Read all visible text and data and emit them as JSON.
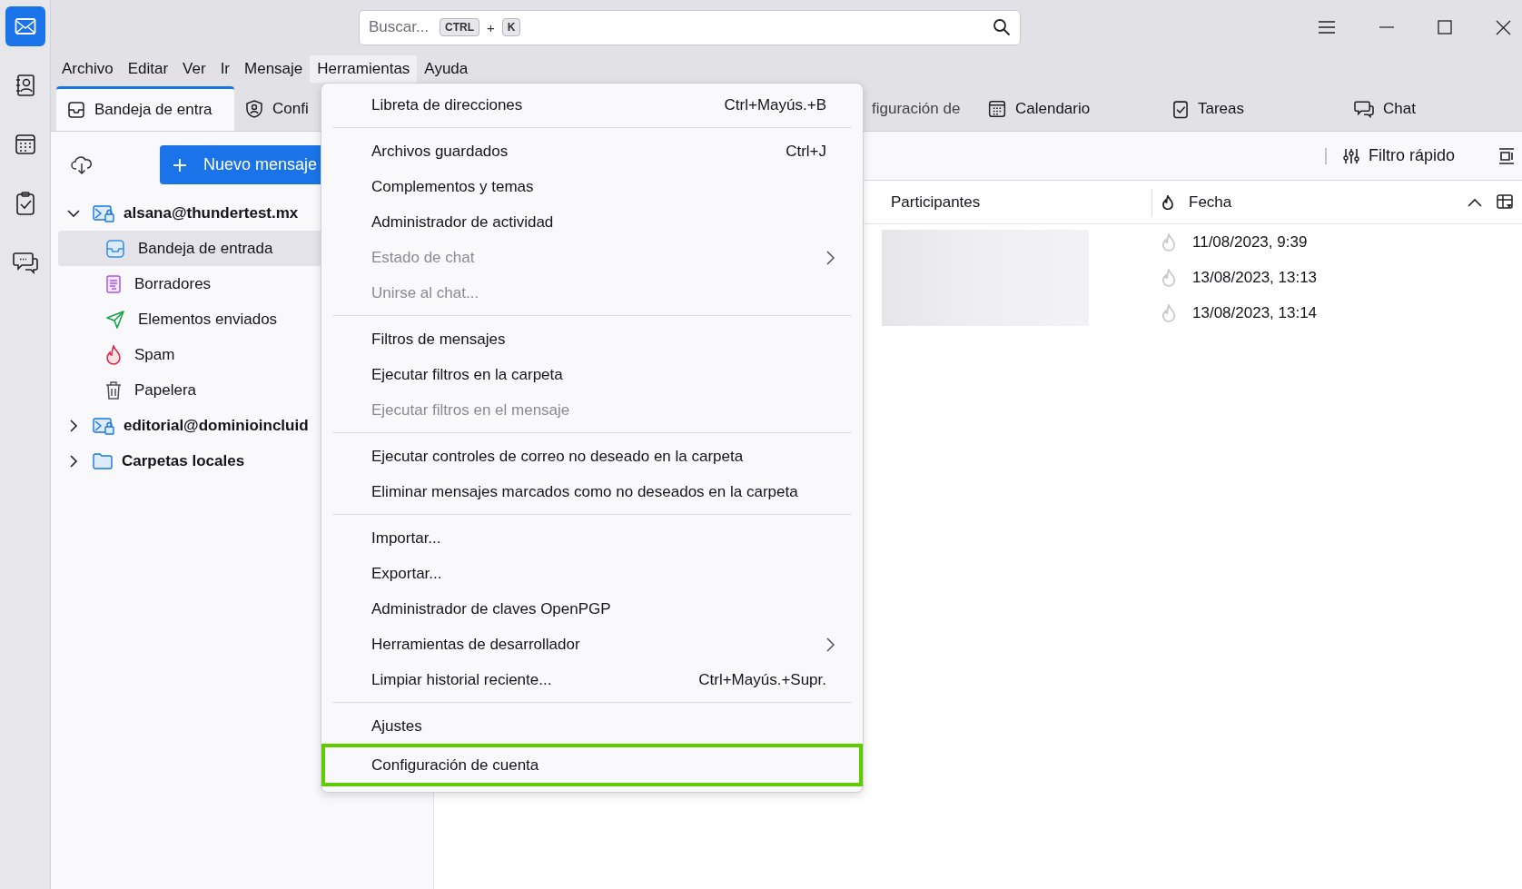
{
  "spaces": [
    {
      "kind": "mail",
      "selected": true
    },
    {
      "kind": "contacts",
      "selected": false
    },
    {
      "kind": "calendar",
      "selected": false
    },
    {
      "kind": "tasks",
      "selected": false
    },
    {
      "kind": "chat",
      "selected": false
    }
  ],
  "search": {
    "placeholder": "Buscar...",
    "shortcut": [
      "CTRL",
      "+",
      "K"
    ]
  },
  "menubar": [
    {
      "label": "Archivo",
      "selected": false
    },
    {
      "label": "Editar",
      "selected": false
    },
    {
      "label": "Ver",
      "selected": false
    },
    {
      "label": "Ir",
      "selected": false
    },
    {
      "label": "Mensaje",
      "selected": false
    },
    {
      "label": "Herramientas",
      "selected": true
    },
    {
      "label": "Ayuda",
      "selected": false
    }
  ],
  "tabs": [
    {
      "label": "Bandeja de entra",
      "kind": "inbox",
      "selected": true
    },
    {
      "label": "Confi",
      "kind": "account",
      "selected": false
    },
    {
      "label": "figuración de",
      "kind": "none",
      "selected": false
    },
    {
      "label": "Calendario",
      "kind": "calendar",
      "selected": false
    },
    {
      "label": "Tareas",
      "kind": "tasks",
      "selected": false
    },
    {
      "label": "Chat",
      "kind": "chat",
      "selected": false
    }
  ],
  "folder_pane": {
    "new_message": "Nuevo mensaje",
    "accounts": [
      {
        "name": "alsana@thundertest.mx",
        "kind": "account",
        "expanded": true,
        "children": [
          {
            "name": "Bandeja de entrada",
            "kind": "inbox",
            "selected": true
          },
          {
            "name": "Borradores",
            "kind": "drafts",
            "selected": false
          },
          {
            "name": "Elementos enviados",
            "kind": "sent",
            "selected": false
          },
          {
            "name": "Spam",
            "kind": "spam",
            "selected": false
          },
          {
            "name": "Papelera",
            "kind": "trash",
            "selected": false
          }
        ]
      },
      {
        "name": "editorial@dominioincluid",
        "kind": "account",
        "expanded": false
      },
      {
        "name": "Carpetas locales",
        "kind": "local",
        "expanded": false
      }
    ]
  },
  "filter": {
    "label": "Filtro rápido"
  },
  "message_list": {
    "columns": [
      "Participantes",
      "Fecha"
    ],
    "rows": [
      {
        "date": "11/08/2023, 9:39"
      },
      {
        "date": "13/08/2023, 13:13"
      },
      {
        "date": "13/08/2023, 13:14"
      }
    ]
  },
  "menu": {
    "groups": [
      [
        {
          "label": "Libreta de direcciones",
          "shortcut": "Ctrl+Mayús.+B",
          "disabled": false,
          "submenu": false,
          "highlighted": false
        }
      ],
      [
        {
          "label": "Archivos guardados",
          "shortcut": "Ctrl+J",
          "disabled": false,
          "submenu": false,
          "highlighted": false
        },
        {
          "label": "Complementos y temas",
          "disabled": false,
          "submenu": false,
          "highlighted": false
        },
        {
          "label": "Administrador de actividad",
          "disabled": false,
          "submenu": false,
          "highlighted": false
        },
        {
          "label": "Estado de chat",
          "disabled": true,
          "submenu": true,
          "highlighted": false
        },
        {
          "label": "Unirse al chat...",
          "disabled": true,
          "submenu": false,
          "highlighted": false
        }
      ],
      [
        {
          "label": "Filtros de mensajes",
          "disabled": false,
          "submenu": false,
          "highlighted": false
        },
        {
          "label": "Ejecutar filtros en la carpeta",
          "disabled": false,
          "submenu": false,
          "highlighted": false
        },
        {
          "label": "Ejecutar filtros en el mensaje",
          "disabled": true,
          "submenu": false,
          "highlighted": false
        }
      ],
      [
        {
          "label": "Ejecutar controles de correo no deseado en la carpeta",
          "disabled": false,
          "submenu": false,
          "highlighted": false
        },
        {
          "label": "Eliminar mensajes marcados como no deseados en la carpeta",
          "disabled": false,
          "submenu": false,
          "highlighted": false
        }
      ],
      [
        {
          "label": "Importar...",
          "disabled": false,
          "submenu": false,
          "highlighted": false
        },
        {
          "label": "Exportar...",
          "disabled": false,
          "submenu": false,
          "highlighted": false
        },
        {
          "label": "Administrador de claves OpenPGP",
          "disabled": false,
          "submenu": false,
          "highlighted": false
        },
        {
          "label": "Herramientas de desarrollador",
          "disabled": false,
          "submenu": true,
          "highlighted": false
        },
        {
          "label": "Limpiar historial reciente...",
          "shortcut": "Ctrl+Mayús.+Supr.",
          "disabled": false,
          "submenu": false,
          "highlighted": false
        }
      ],
      [
        {
          "label": "Ajustes",
          "disabled": false,
          "submenu": false,
          "highlighted": false
        },
        {
          "label": "Configuración de cuenta",
          "disabled": false,
          "submenu": false,
          "highlighted": true
        }
      ]
    ]
  }
}
